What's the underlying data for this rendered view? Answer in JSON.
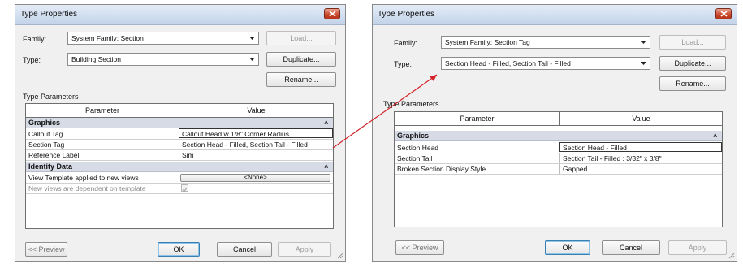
{
  "left_dialog": {
    "title": "Type Properties",
    "family_label": "Family:",
    "family_value": "System Family: Section",
    "type_label": "Type:",
    "type_value": "Building Section",
    "load_label": "Load...",
    "duplicate_label": "Duplicate...",
    "rename_label": "Rename...",
    "section_title": "Type Parameters",
    "col_parameter": "Parameter",
    "col_value": "Value",
    "groups": [
      {
        "name": "Graphics",
        "rows": [
          {
            "param": "Callout Tag",
            "value": "Callout Head w 1/8\" Corner Radius"
          },
          {
            "param": "Section Tag",
            "value": "Section Head - Filled, Section Tail - Filled"
          },
          {
            "param": "Reference Label",
            "value": "Sim"
          }
        ]
      },
      {
        "name": "Identity Data",
        "rows": [
          {
            "param": "View Template applied to new views",
            "value": "<None>"
          },
          {
            "param": "New views are dependent on template",
            "value": ""
          }
        ]
      }
    ],
    "preview_label": "<< Preview",
    "ok_label": "OK",
    "cancel_label": "Cancel",
    "apply_label": "Apply"
  },
  "right_dialog": {
    "title": "Type Properties",
    "family_label": "Family:",
    "family_value": "System Family: Section Tag",
    "type_label": "Type:",
    "type_value": "Section Head - Filled, Section Tail - Filled",
    "load_label": "Load...",
    "duplicate_label": "Duplicate...",
    "rename_label": "Rename...",
    "section_title": "Type Parameters",
    "col_parameter": "Parameter",
    "col_value": "Value",
    "groups": [
      {
        "name": "Graphics",
        "rows": [
          {
            "param": "Section Head",
            "value": "Section Head - Filled"
          },
          {
            "param": "Section Tail",
            "value": "Section Tail - Filled : 3/32\" x 3/8\""
          },
          {
            "param": "Broken Section Display Style",
            "value": "Gapped"
          }
        ]
      }
    ],
    "preview_label": "<< Preview",
    "ok_label": "OK",
    "cancel_label": "Cancel",
    "apply_label": "Apply"
  },
  "colors": {
    "connector": "#d2232a",
    "group_header": "#d6dbe6",
    "title_bar": "#d2dff0",
    "close_button": "#c8442a"
  }
}
